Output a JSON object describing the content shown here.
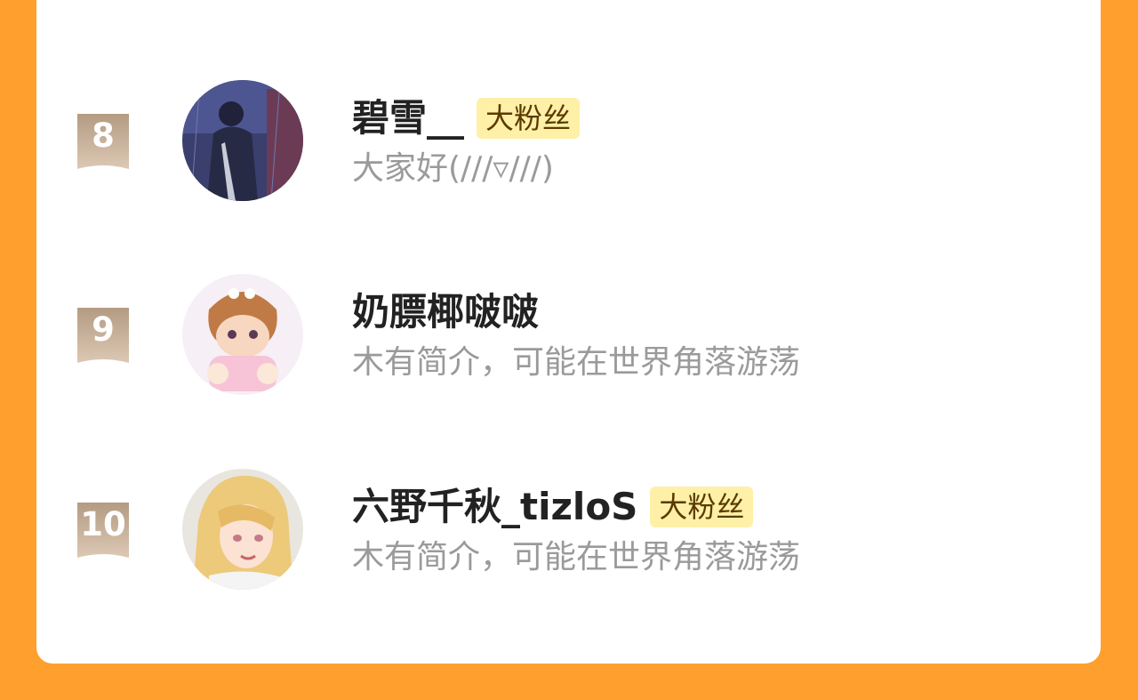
{
  "colors": {
    "background": "#FF9F2E",
    "card": "#FFFFFF",
    "rank_badge": "#CDB59A",
    "fan_badge_bg": "#FFF0A8",
    "name_text": "#222222",
    "bio_text": "#9A9A9A"
  },
  "rows": [
    {
      "rank": "8",
      "name": "碧雪__",
      "badge": "大粉丝",
      "bio": "大家好(///▿///)"
    },
    {
      "rank": "9",
      "name": "奶膘椰啵啵",
      "badge": "",
      "bio": "木有简介，可能在世界角落游荡"
    },
    {
      "rank": "10",
      "name": "六野千秋_tizloS",
      "badge": "大粉丝",
      "bio": "木有简介，可能在世界角落游荡"
    }
  ]
}
